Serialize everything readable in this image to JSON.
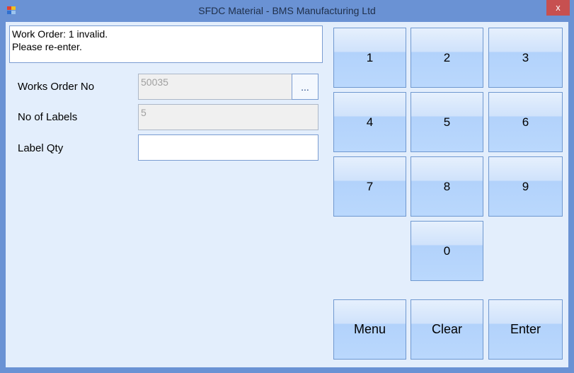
{
  "window": {
    "title": "SFDC Material - BMS Manufacturing Ltd",
    "close_label": "x"
  },
  "message": {
    "lines": [
      "Work Order: 1 invalid.",
      "Please re-enter."
    ]
  },
  "form": {
    "works_order_label": "Works Order No",
    "works_order_value": "50035",
    "lookup_label": "...",
    "no_labels_label": "No of Labels",
    "no_labels_value": "5",
    "label_qty_label": "Label Qty",
    "label_qty_value": ""
  },
  "keypad": {
    "keys": [
      "1",
      "2",
      "3",
      "4",
      "5",
      "6",
      "7",
      "8",
      "9",
      "0"
    ],
    "menu": "Menu",
    "clear": "Clear",
    "enter": "Enter"
  }
}
